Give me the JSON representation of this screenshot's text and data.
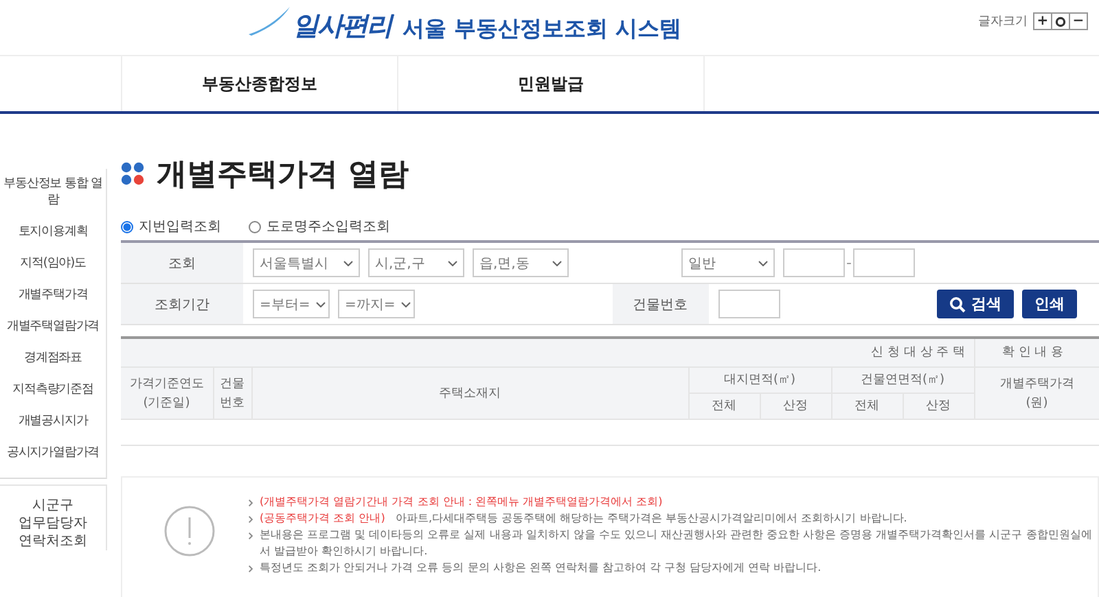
{
  "header": {
    "logo": "일사편리",
    "system_name": "서울 부동산정보조회 시스템",
    "font_size_label": "글자크기",
    "font_buttons": [
      {
        "kind": "glyph",
        "label": "+"
      },
      {
        "kind": "reset"
      },
      {
        "kind": "glyph",
        "label": "−"
      }
    ]
  },
  "nav": [
    {
      "label": "부동산종합정보"
    },
    {
      "label": "민원발급"
    }
  ],
  "sidebar": {
    "items": [
      "부동산정보 통합 열람",
      "토지이용계획",
      "지적(임야)도",
      "개별주택가격",
      "개별주택열람가격",
      "경계점좌표",
      "지적측량기준점",
      "개별공시지가",
      "공시지가열람가격"
    ],
    "contact_lines": [
      "시군구",
      "업무담당자",
      "연락처조회"
    ]
  },
  "page_title": "개별주택가격 열람",
  "search_modes": [
    {
      "label": "지번입력조회",
      "selected": true
    },
    {
      "label": "도로명주소입력조회",
      "selected": false
    }
  ],
  "form": {
    "row1_label": "조회",
    "city": "서울특별시",
    "district": "시,군,구",
    "dong": "읍,면,동",
    "land_type": "일반",
    "bunji_separator": "-",
    "row2_label": "조회기간",
    "from": "=부터=",
    "to": "=까지=",
    "building_label": "건물번호",
    "search_button": "검색",
    "print_button": "인쇄"
  },
  "table": {
    "group_applicant": "신 청 대 상 주 택",
    "group_confirm": "확 인 내 용",
    "year_lines": [
      "가격기준연도",
      "(기준일)"
    ],
    "building_no_lines": [
      "건물",
      "번호"
    ],
    "address": "주택소재지",
    "land_area": "대지면적(㎡)",
    "floor_area": "건물연면적(㎡)",
    "price_lines": [
      "개별주택가격",
      "(원)"
    ],
    "sub": [
      "전체",
      "산정",
      "전체",
      "산정"
    ]
  },
  "notices": [
    {
      "highlight": "(개별주택가격 열람기간내 가격 조회 안내 : 왼쪽메뉴 개별주택열람가격에서 조회)"
    },
    {
      "highlight": "(공동주택가격 조회 안내)",
      "text": "아파트,다세대주택등 공동주택에 해당하는 주택가격은 부동산공시가격알리미에서 조회하시기 바랍니다."
    },
    {
      "text": "본내용은 프로그램 및 데이타등의 오류로 실제 내용과 일치하지 않을 수도 있으니 재산권행사와 관련한 중요한 사항은 증명용 개별주택가격확인서를 시군구 종합민원실에서 발급받아 확인하시기 바랍니다."
    },
    {
      "text": "특정년도 조회가 안되거나 가격 오류 등의 문의 사항은 왼쪽 연락처를 참고하여 각 구청 담당자에게 연락 바랍니다."
    }
  ]
}
